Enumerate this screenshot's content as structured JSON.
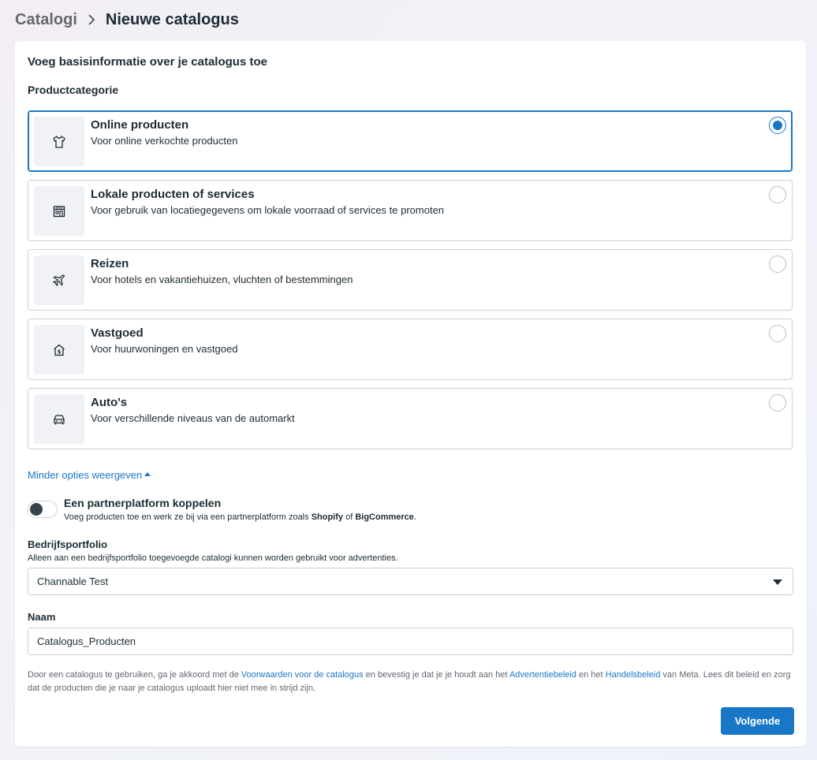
{
  "breadcrumb": {
    "root": "Catalogi",
    "current": "Nieuwe catalogus"
  },
  "section_title": "Voeg basisinformatie over je catalogus toe",
  "category_label": "Productcategorie",
  "options": [
    {
      "title": "Online producten",
      "desc": "Voor online verkochte producten",
      "icon": "shirt-icon",
      "selected": true
    },
    {
      "title": "Lokale producten of services",
      "desc": "Voor gebruik van locatiegegevens om lokale voorraad of services te promoten",
      "icon": "storefront-icon",
      "selected": false
    },
    {
      "title": "Reizen",
      "desc": "Voor hotels en vakantiehuizen, vluchten of bestemmingen",
      "icon": "airplane-icon",
      "selected": false
    },
    {
      "title": "Vastgoed",
      "desc": "Voor huurwoningen en vastgoed",
      "icon": "house-dollar-icon",
      "selected": false
    },
    {
      "title": "Auto's",
      "desc": "Voor verschillende niveaus van de automarkt",
      "icon": "car-icon",
      "selected": false
    }
  ],
  "less_options": "Minder opties weergeven",
  "partner": {
    "title": "Een partnerplatform koppelen",
    "desc_prefix": "Voeg producten toe en werk ze bij via een partnerplatform zoals ",
    "shopify": "Shopify",
    "of": " of ",
    "bigcommerce": "BigCommerce",
    "period": ".",
    "enabled": false
  },
  "portfolio": {
    "label": "Bedrijfsportfolio",
    "help": "Alleen aan een bedrijfsportfolio toegevoegde catalogi kunnen worden gebruikt voor advertenties.",
    "value": "Channable Test"
  },
  "name": {
    "label": "Naam",
    "value": "Catalogus_Producten"
  },
  "legal": {
    "t1": "Door een catalogus te gebruiken, ga je akkoord met de ",
    "l1": "Voorwaarden voor de catalogus",
    "t2": " en bevestig je dat je je houdt aan het ",
    "l2": "Advertentiebeleid",
    "t3": " en het ",
    "l3": "Handelsbeleid",
    "t4": " van Meta. Lees dit beleid en zorg dat de producten die je naar je catalogus uploadt hier niet mee in strijd zijn."
  },
  "next_button": "Volgende",
  "colors": {
    "accent": "#1877c7",
    "text": "#1c2b33",
    "border": "#cbd2d9"
  }
}
